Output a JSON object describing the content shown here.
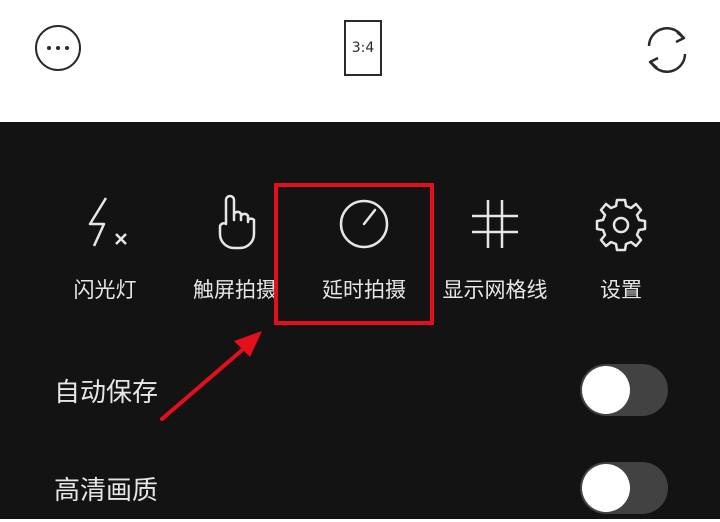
{
  "top_bar": {
    "ratio_label": "3:4"
  },
  "tools": [
    {
      "label": "闪光灯",
      "icon": "flash-off-icon"
    },
    {
      "label": "触屏拍摄",
      "icon": "touch-hand-icon"
    },
    {
      "label": "延时拍摄",
      "icon": "timer-icon"
    },
    {
      "label": "显示网格线",
      "icon": "grid-icon"
    },
    {
      "label": "设置",
      "icon": "gear-icon"
    }
  ],
  "settings": [
    {
      "label": "自动保存",
      "enabled": false
    },
    {
      "label": "高清画质",
      "enabled": false
    }
  ],
  "colors": {
    "panel_bg": "#141314",
    "highlight": "#e3101c",
    "toggle_off": "#424242"
  }
}
